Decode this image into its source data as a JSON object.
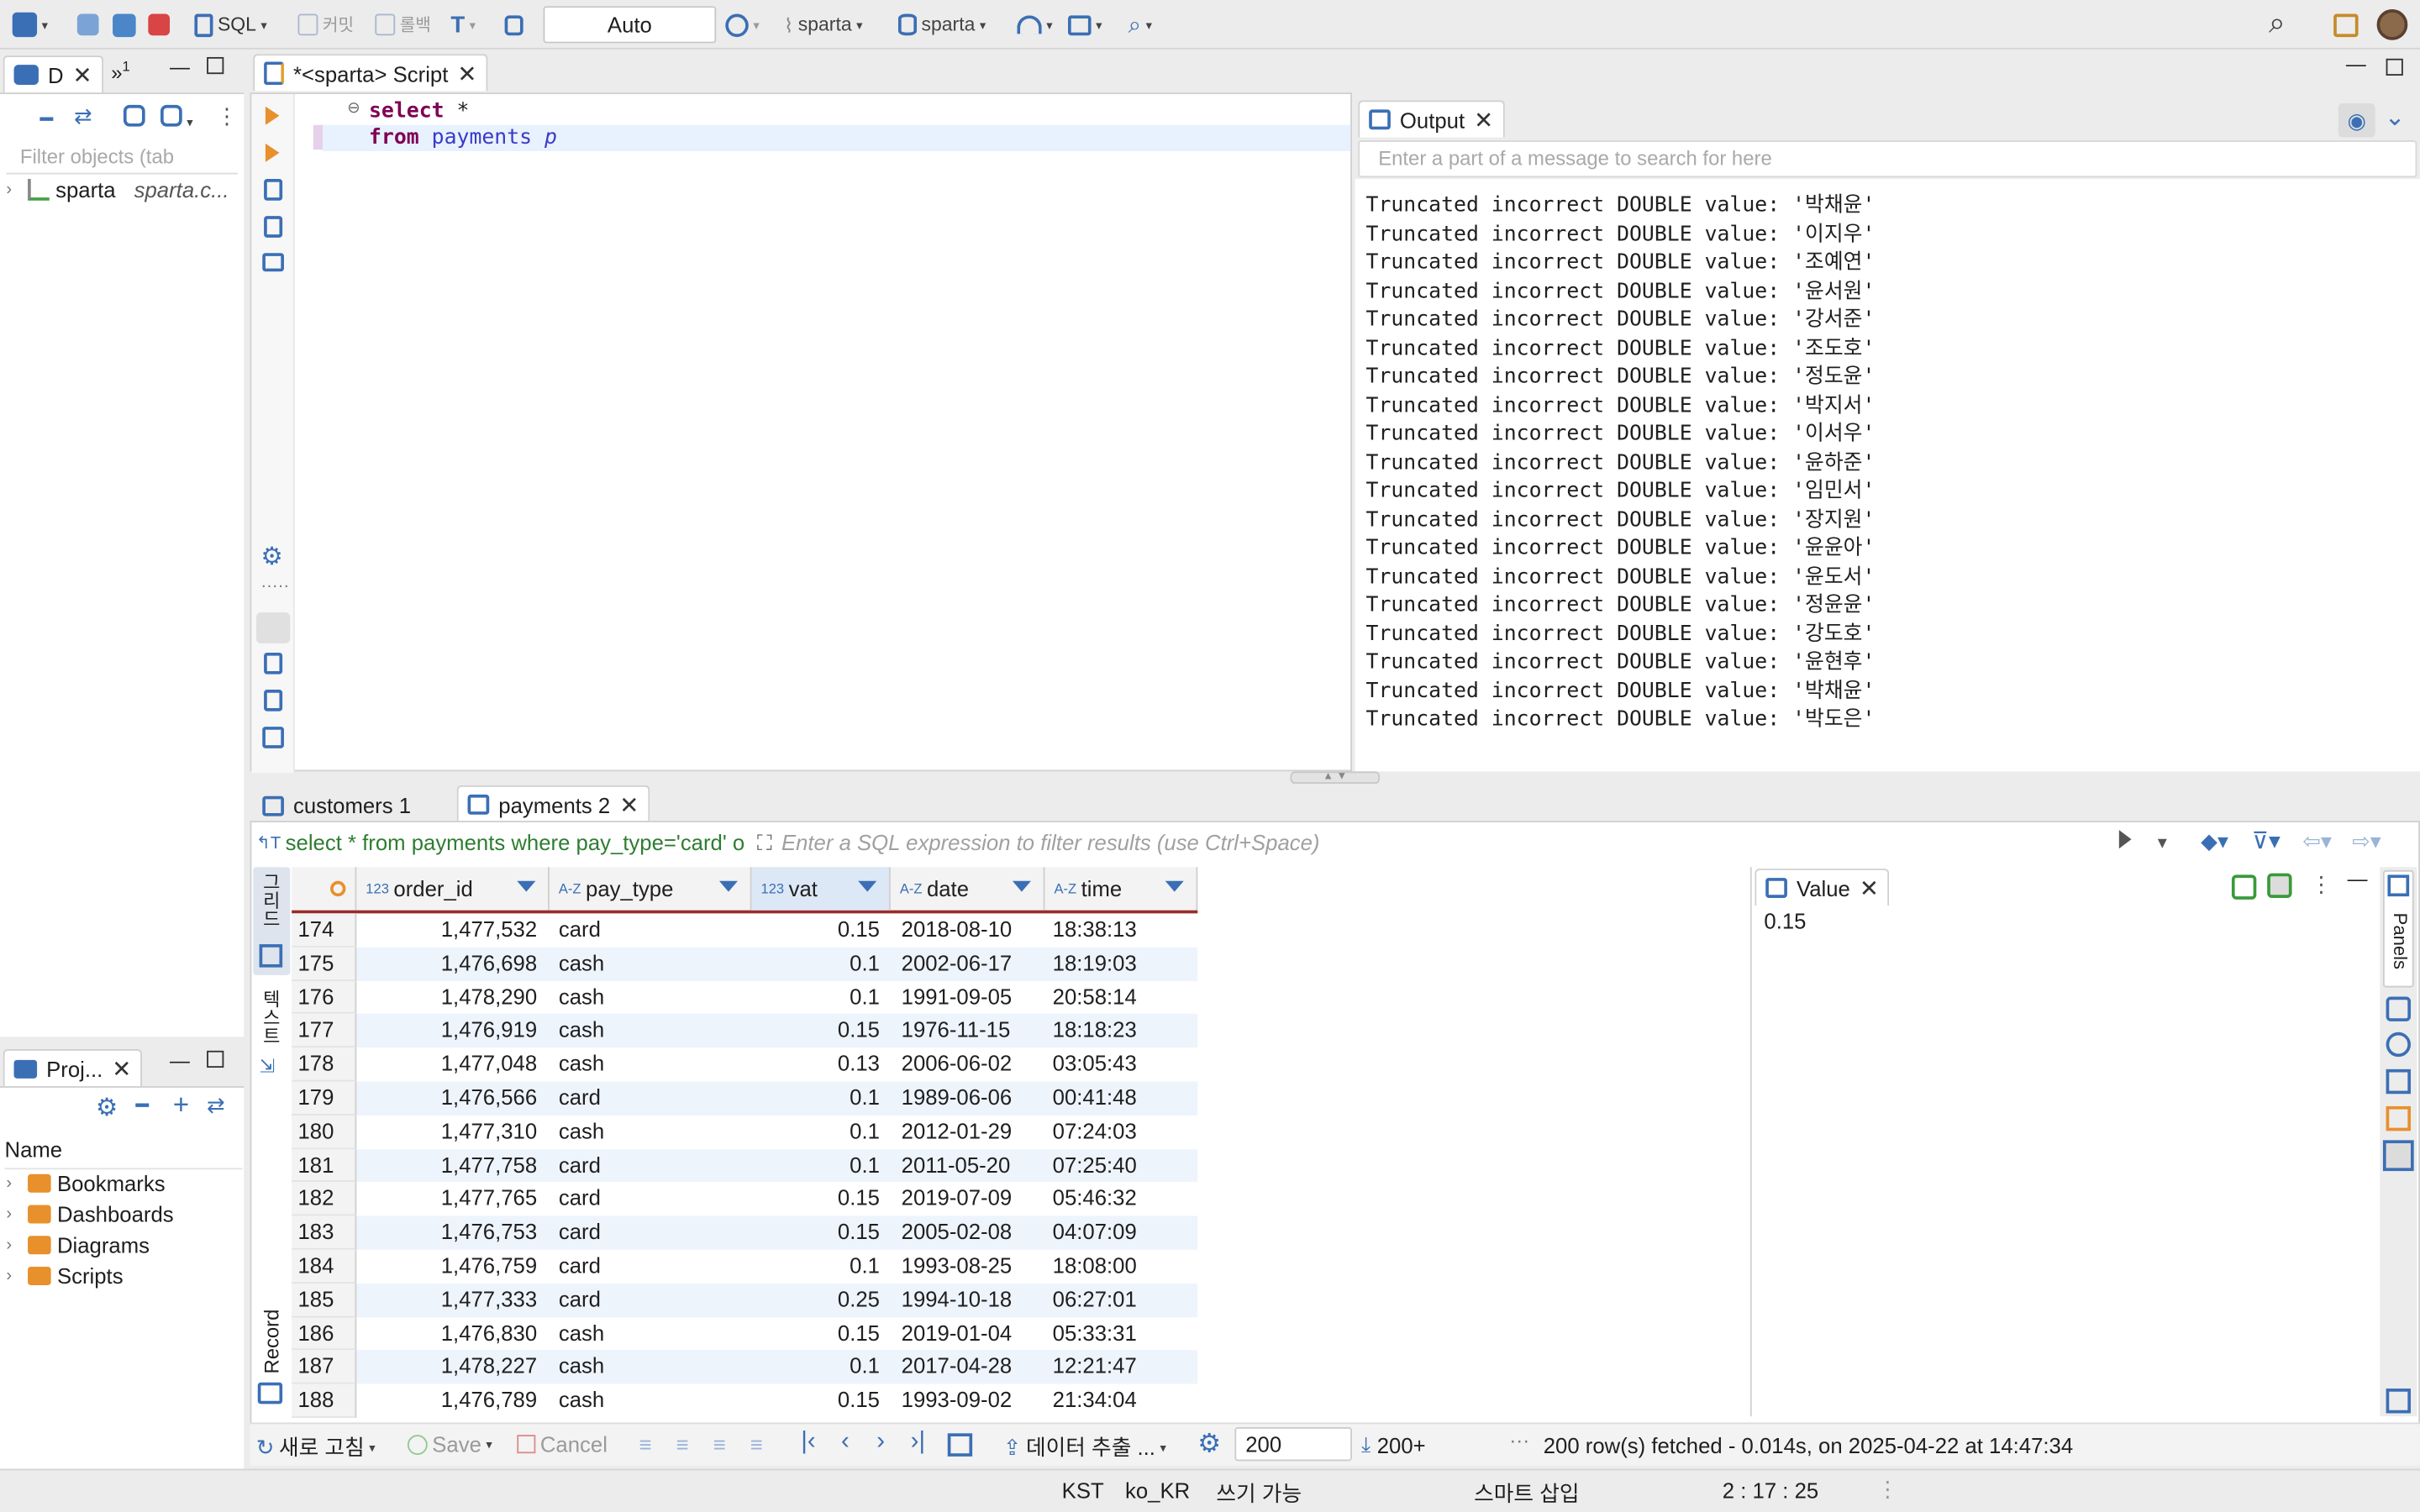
{
  "colors": {
    "accent": "#3b6fb5",
    "keyword": "#7f0055",
    "table_name": "#3a3ac9",
    "header_border": "#9b2a2a"
  },
  "toolbar": {
    "sql_label": "SQL",
    "commit_label": "커밋",
    "rollback_label": "롤백",
    "mode_value": "Auto",
    "connection_label": "sparta",
    "database_label": "sparta"
  },
  "navigator": {
    "tab_label": "D",
    "tab2_label": "1",
    "filter_placeholder": "Filter objects (tab",
    "connection": {
      "name": "sparta",
      "detail": "sparta.c..."
    }
  },
  "projects": {
    "tab_label": "Proj...",
    "column_header": "Name",
    "items": [
      {
        "label": "Bookmarks",
        "color": "#e8902c"
      },
      {
        "label": "Dashboards",
        "color": "#e8902c"
      },
      {
        "label": "Diagrams",
        "color": "#e8902c"
      },
      {
        "label": "Scripts",
        "color": "#e8902c"
      }
    ]
  },
  "editor": {
    "tab_label": "*<sparta> Script",
    "line1_kw": "select",
    "line1_rest": " *",
    "line2_kw": "from",
    "line2_table": "payments",
    "line2_alias": "p"
  },
  "output": {
    "tab_label": "Output",
    "search_placeholder": "Enter a part of a message to search for here",
    "lines": [
      "Truncated incorrect DOUBLE value: '박채윤'",
      "Truncated incorrect DOUBLE value: '이지우'",
      "Truncated incorrect DOUBLE value: '조예연'",
      "Truncated incorrect DOUBLE value: '윤서원'",
      "Truncated incorrect DOUBLE value: '강서준'",
      "Truncated incorrect DOUBLE value: '조도호'",
      "Truncated incorrect DOUBLE value: '정도윤'",
      "Truncated incorrect DOUBLE value: '박지서'",
      "Truncated incorrect DOUBLE value: '이서우'",
      "Truncated incorrect DOUBLE value: '윤하준'",
      "Truncated incorrect DOUBLE value: '임민서'",
      "Truncated incorrect DOUBLE value: '장지원'",
      "Truncated incorrect DOUBLE value: '윤윤아'",
      "Truncated incorrect DOUBLE value: '윤도서'",
      "Truncated incorrect DOUBLE value: '정윤윤'",
      "Truncated incorrect DOUBLE value: '강도호'",
      "Truncated incorrect DOUBLE value: '윤현후'",
      "Truncated incorrect DOUBLE value: '박채윤'",
      "Truncated incorrect DOUBLE value: '박도은'"
    ]
  },
  "results": {
    "tabs": [
      {
        "label": "customers 1"
      },
      {
        "label": "payments 2"
      }
    ],
    "query_text": "select * from payments where pay_type='card' o",
    "filter_placeholder": "Enter a SQL expression to filter results (use Ctrl+Space)",
    "side_labels": {
      "grid": "그리드",
      "text": "텍스트",
      "record": "Record"
    },
    "columns": [
      {
        "type": "123",
        "name": "order_id"
      },
      {
        "type": "A-Z",
        "name": "pay_type"
      },
      {
        "type": "123",
        "name": "vat"
      },
      {
        "type": "A-Z",
        "name": "date"
      },
      {
        "type": "A-Z",
        "name": "time"
      }
    ],
    "rows": [
      [
        "174",
        "1,477,532",
        "card",
        "0.15",
        "2018-08-10",
        "18:38:13"
      ],
      [
        "175",
        "1,476,698",
        "cash",
        "0.1",
        "2002-06-17",
        "18:19:03"
      ],
      [
        "176",
        "1,478,290",
        "cash",
        "0.1",
        "1991-09-05",
        "20:58:14"
      ],
      [
        "177",
        "1,476,919",
        "cash",
        "0.15",
        "1976-11-15",
        "18:18:23"
      ],
      [
        "178",
        "1,477,048",
        "cash",
        "0.13",
        "2006-06-02",
        "03:05:43"
      ],
      [
        "179",
        "1,476,566",
        "card",
        "0.1",
        "1989-06-06",
        "00:41:48"
      ],
      [
        "180",
        "1,477,310",
        "cash",
        "0.1",
        "2012-01-29",
        "07:24:03"
      ],
      [
        "181",
        "1,477,758",
        "card",
        "0.1",
        "2011-05-20",
        "07:25:40"
      ],
      [
        "182",
        "1,477,765",
        "card",
        "0.15",
        "2019-07-09",
        "05:46:32"
      ],
      [
        "183",
        "1,476,753",
        "card",
        "0.15",
        "2005-02-08",
        "04:07:09"
      ],
      [
        "184",
        "1,476,759",
        "card",
        "0.1",
        "1993-08-25",
        "18:08:00"
      ],
      [
        "185",
        "1,477,333",
        "card",
        "0.25",
        "1994-10-18",
        "06:27:01"
      ],
      [
        "186",
        "1,476,830",
        "cash",
        "0.15",
        "2019-01-04",
        "05:33:31"
      ],
      [
        "187",
        "1,478,227",
        "cash",
        "0.1",
        "2017-04-28",
        "12:21:47"
      ],
      [
        "188",
        "1,476,789",
        "cash",
        "0.15",
        "1993-09-02",
        "21:34:04"
      ]
    ],
    "value_panel": {
      "tab_label": "Value",
      "value": "0.15",
      "panels_label": "Panels"
    },
    "bottom": {
      "refresh_label": "새로 고침",
      "save_label": "Save",
      "cancel_label": "Cancel",
      "export_label": "데이터 추출 ...",
      "fetch_size": "200",
      "fetch_more": "200+",
      "status": "200 row(s) fetched - 0.014s, on 2025-04-22 at 14:47:34"
    }
  },
  "statusbar": {
    "timezone": "KST",
    "locale": "ko_KR",
    "write_mode": "쓰기 가능",
    "insert_mode": "스마트 삽입",
    "position": "2 : 17 : 25"
  }
}
